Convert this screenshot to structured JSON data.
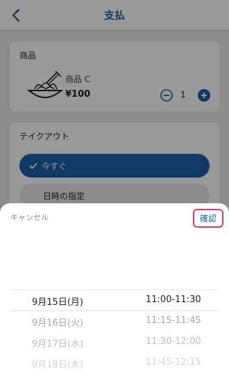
{
  "header": {
    "title": "支払",
    "back_icon": "chevron-left-icon"
  },
  "product_section": {
    "label": "商品",
    "item": {
      "name": "商品 C",
      "price": "¥100",
      "quantity": "1",
      "image_icon": "pasta-plate-icon"
    }
  },
  "takeout_section": {
    "label": "テイクアウト",
    "option_now": "今すぐ",
    "option_scheduled": "日時の指定"
  },
  "sheet": {
    "cancel_label": "キャンセル",
    "confirm_label": "確認",
    "rows": [
      {
        "date": "9月15日(月)",
        "time": "11:00-11:30"
      },
      {
        "date": "9月16日(火)",
        "time": "11:15-11:45"
      },
      {
        "date": "9月17日(水)",
        "time": "11:30-12:00"
      },
      {
        "date": "9月18日(木)",
        "time": "11:45-12:15"
      }
    ]
  },
  "colors": {
    "accent": "#1d5fa8",
    "highlight": "#e3307a"
  }
}
